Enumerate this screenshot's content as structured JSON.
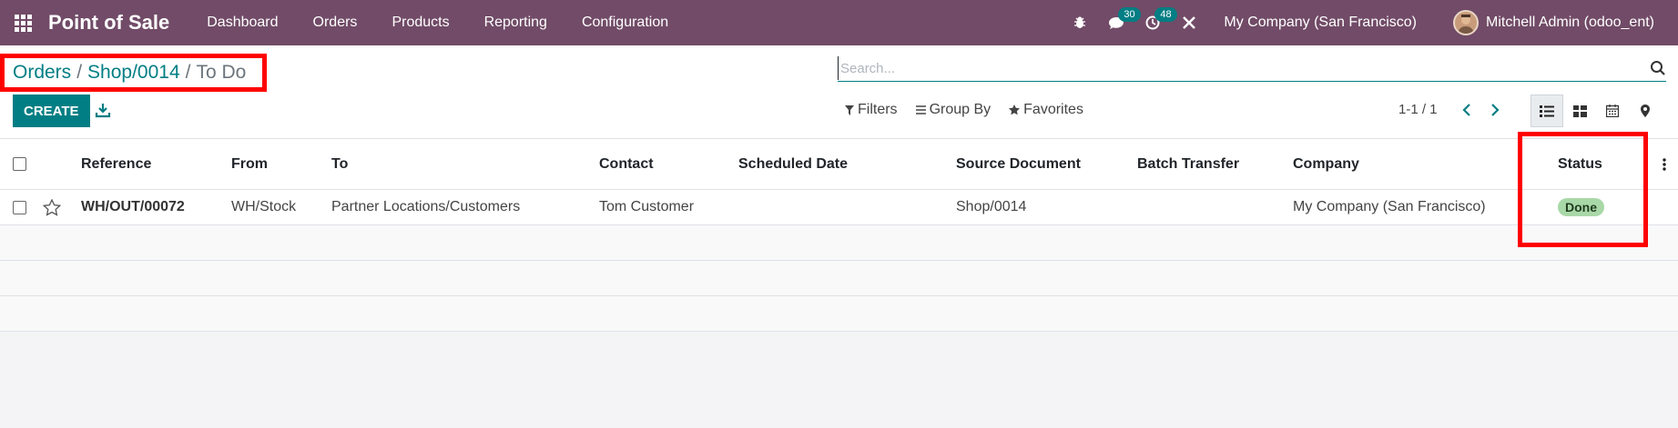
{
  "navbar": {
    "brand": "Point of Sale",
    "menu": [
      "Dashboard",
      "Orders",
      "Products",
      "Reporting",
      "Configuration"
    ],
    "messages_count": "30",
    "activities_count": "48",
    "company": "My Company (San Francisco)",
    "user": "Mitchell Admin (odoo_ent)"
  },
  "breadcrumb": {
    "items": [
      "Orders",
      "Shop/0014"
    ],
    "separator": "/",
    "active": "To Do"
  },
  "search": {
    "placeholder": "Search..."
  },
  "toolbar": {
    "create_label": "CREATE",
    "filters_label": "Filters",
    "groupby_label": "Group By",
    "favorites_label": "Favorites",
    "pager": "1-1 / 1"
  },
  "table": {
    "columns": [
      "Reference",
      "From",
      "To",
      "Contact",
      "Scheduled Date",
      "Source Document",
      "Batch Transfer",
      "Company",
      "Status"
    ],
    "rows": [
      {
        "reference": "WH/OUT/00072",
        "from": "WH/Stock",
        "to": "Partner Locations/Customers",
        "contact": "Tom Customer",
        "scheduled_date": "",
        "source_document": "Shop/0014",
        "batch_transfer": "",
        "company": "My Company (San Francisco)",
        "status": "Done"
      }
    ]
  },
  "colors": {
    "navbar": "#714b67",
    "primary": "#017e84",
    "highlight": "#ff0000",
    "status_done": "#a9d8a8"
  }
}
